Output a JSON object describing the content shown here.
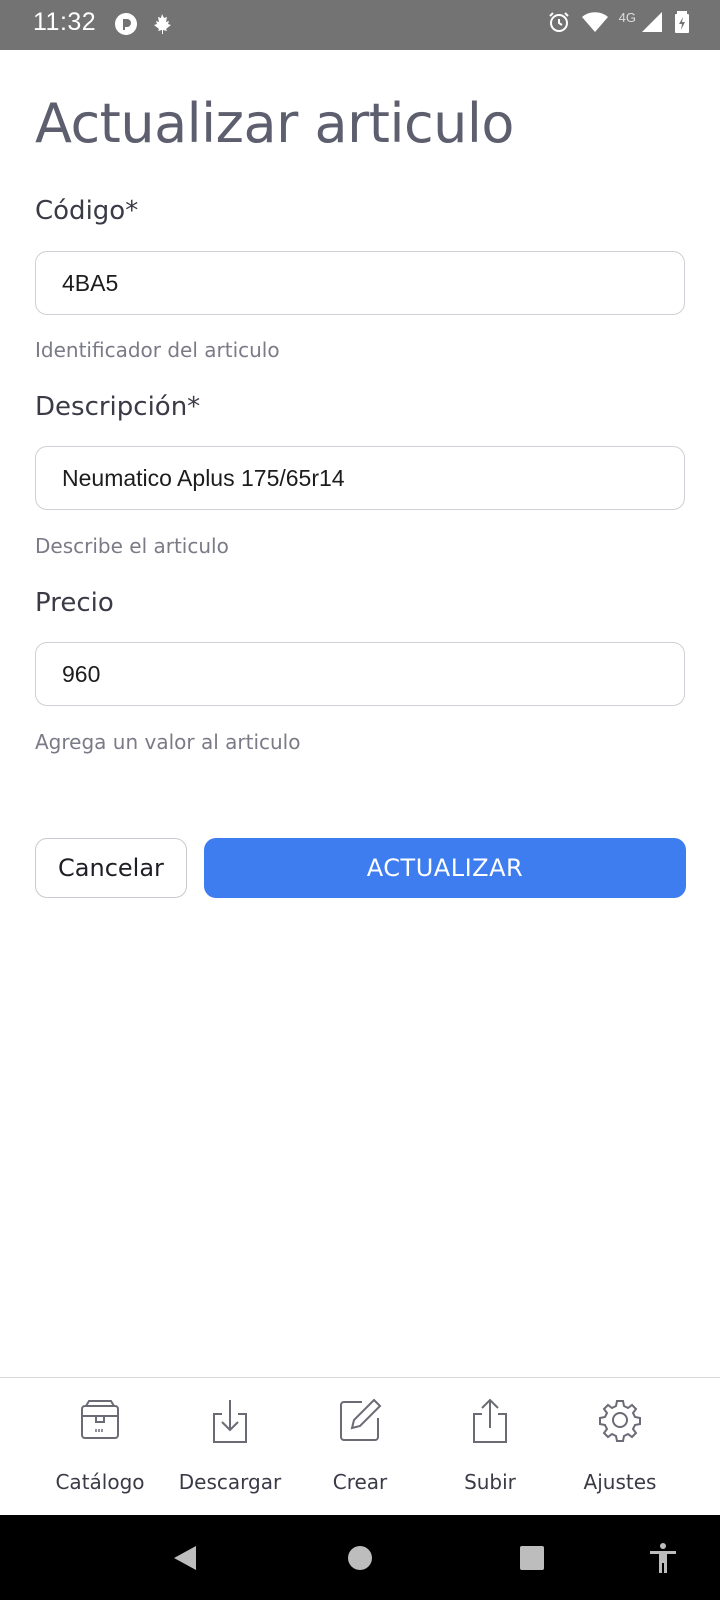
{
  "status_bar": {
    "time": "11:32",
    "network_label": "4G",
    "icons": [
      "pocket-casts-icon",
      "maple-leaf-icon",
      "alarm-icon",
      "wifi-icon",
      "signal-icon",
      "battery-icon"
    ]
  },
  "page": {
    "title": "Actualizar articulo"
  },
  "form": {
    "codigo": {
      "label": "Código*",
      "value": "4BA5",
      "helper": "Identificador del articulo"
    },
    "descripcion": {
      "label": "Descripción*",
      "value": "Neumatico Aplus 175/65r14",
      "helper": "Describe el articulo"
    },
    "precio": {
      "label": "Precio",
      "value": "960",
      "helper": "Agrega un valor al articulo"
    },
    "cancel_label": "Cancelar",
    "submit_label": "ACTUALIZAR"
  },
  "bottom_nav": {
    "items": [
      {
        "label": "Catálogo",
        "icon": "box-icon"
      },
      {
        "label": "Descargar",
        "icon": "download-icon"
      },
      {
        "label": "Crear",
        "icon": "edit-icon"
      },
      {
        "label": "Subir",
        "icon": "upload-icon"
      },
      {
        "label": "Ajustes",
        "icon": "gear-icon"
      }
    ]
  },
  "colors": {
    "accent": "#3d7df0",
    "status_bar": "#737373",
    "title": "#5d5e6e"
  }
}
